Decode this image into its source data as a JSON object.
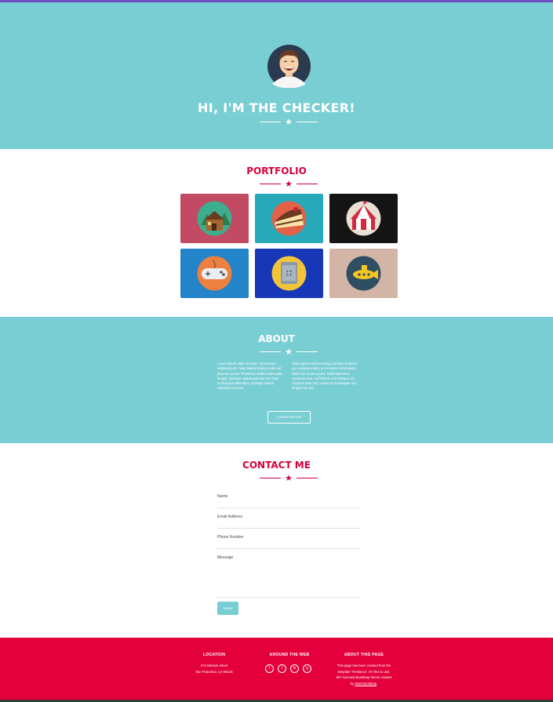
{
  "hero": {
    "title": "HI, I'M THE CHECKER!"
  },
  "portfolio": {
    "title": "PORTFOLIO",
    "items": [
      {
        "name": "cabin",
        "bg": "#c24a63"
      },
      {
        "name": "cake",
        "bg": "#27a9ba"
      },
      {
        "name": "circus",
        "bg": "#141414"
      },
      {
        "name": "game",
        "bg": "#2484c9"
      },
      {
        "name": "safe",
        "bg": "#1638b8"
      },
      {
        "name": "submarine",
        "bg": "#d2b5a6"
      }
    ]
  },
  "about": {
    "title": "ABOUT",
    "col_left": "Lorem ipsum dolor sit amet, consectetur adipiscing elit. Nam blandit turpis iaculis nisl pharetra auctor. Phasellus mattis malesuada feugiat. Quisque malesuada orci non risus scelerisque bibendum. Quisque viverra vulputate posuere.",
    "col_right": "Class aptent taciti sociosqu ad litora torquent per conubia nostra, per inceptos himenaeos. Nulla non ornare purus. Nulla bibendum maximus urna, sed finibus velit tristique vel. Vivamus ante nisl, cursus at scelerisque nec, feugiat non dui.",
    "download_label": "Download me!"
  },
  "contact": {
    "title": "CONTACT ME",
    "name_label": "Name",
    "email_label": "Email Address",
    "phone_label": "Phone Number",
    "message_label": "Message",
    "send_label": "Send"
  },
  "footer": {
    "location_title": "LOCATION",
    "location_line1": "972 Mission street",
    "location_line2": "San Francisco, CA 94134",
    "web_title": "AROUND THE WEB",
    "social_icons": [
      "facebook-icon",
      "twitter-icon",
      "linkedin-icon",
      "dribbble-icon"
    ],
    "about_title": "ABOUT THIS PAGE",
    "about_line1": "This page has been created from the",
    "about_line2": "template 'Freelance'. It's free to use,",
    "about_line3": "MIT licensed Bootstrap theme created",
    "about_line4_prefix": "by",
    "about_link": "Start Bootstrap",
    "about_line4_suffix": "."
  },
  "colors": {
    "accent": "#78ced3",
    "brand_red": "#e4003a",
    "title_red": "#d6003a"
  }
}
